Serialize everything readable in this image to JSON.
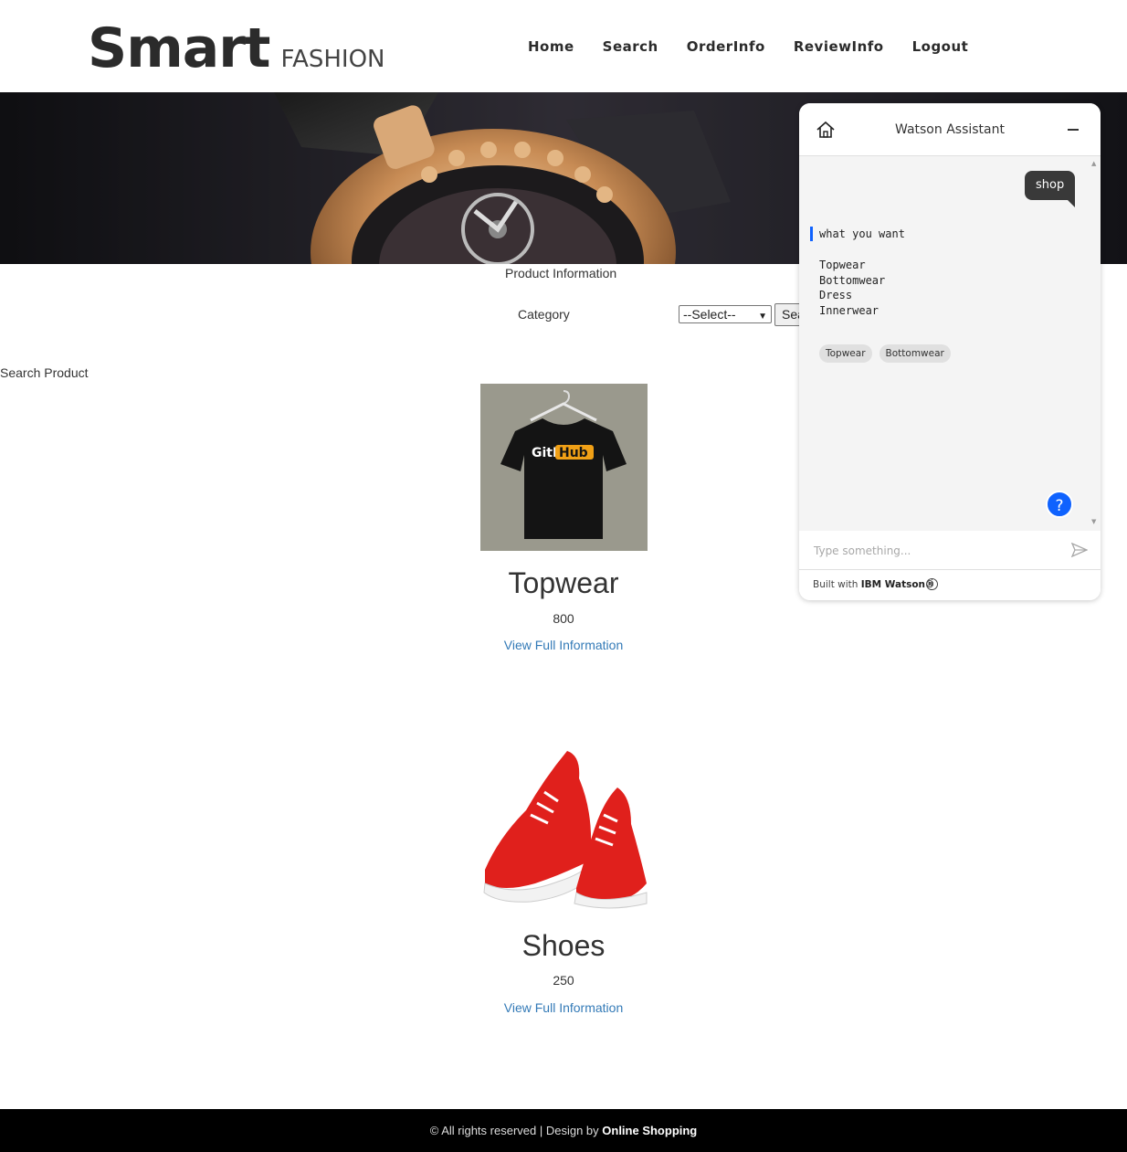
{
  "header": {
    "logo_main": "Smart",
    "logo_sub": "FASHION",
    "nav": [
      "Home",
      "Search",
      "OrderInfo",
      "ReviewInfo",
      "Logout"
    ]
  },
  "content": {
    "product_info_title": "Product Information",
    "category_label": "Category",
    "category_selected": "--Select--",
    "search_button": "Search",
    "search_product_label": "Search Product"
  },
  "products": [
    {
      "name": "Topwear",
      "price": "800",
      "link": "View Full Information",
      "image_text": "GitHub"
    },
    {
      "name": "Shoes",
      "price": "250",
      "link": "View Full Information"
    }
  ],
  "footer": {
    "prefix": "© All rights reserved | Design by ",
    "brand": "Online Shopping"
  },
  "watson": {
    "title": "Watson Assistant",
    "user_message": "shop",
    "bot_prompt": "what you want",
    "bot_options": [
      "Topwear",
      "Bottomwear",
      "Dress",
      "Innerwear"
    ],
    "chips": [
      "Topwear",
      "Bottomwear"
    ],
    "input_placeholder": "Type something...",
    "help_label": "?",
    "built_prefix": "Built with ",
    "built_brand": "IBM Watson®",
    "accent_color": "#0f62fe"
  }
}
